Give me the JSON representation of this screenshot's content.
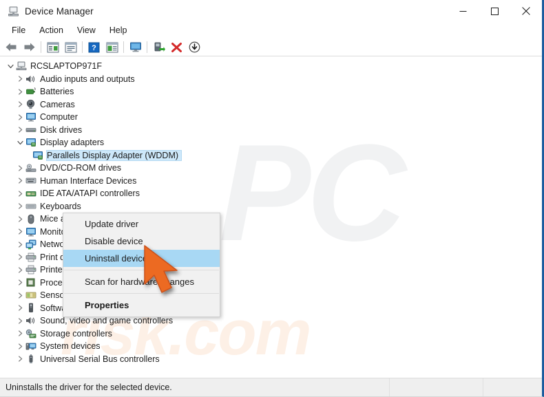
{
  "window": {
    "title": "Device Manager",
    "app_icon": "device-manager-icon",
    "controls": {
      "minimize": "–",
      "maximize": "□",
      "close": "✕"
    }
  },
  "menubar": {
    "items": [
      {
        "label": "File"
      },
      {
        "label": "Action"
      },
      {
        "label": "View"
      },
      {
        "label": "Help"
      }
    ]
  },
  "toolbar": {
    "buttons": [
      {
        "icon": "back-arrow-icon",
        "name": "back-button"
      },
      {
        "icon": "forward-arrow-icon",
        "name": "forward-button"
      },
      {
        "separator": true
      },
      {
        "icon": "show-hide-console-tree-icon",
        "name": "show-console-tree-button"
      },
      {
        "icon": "properties-icon",
        "name": "properties-button"
      },
      {
        "separator": true
      },
      {
        "icon": "help-icon",
        "name": "help-button"
      },
      {
        "icon": "update-driver-icon",
        "name": "update-driver-button"
      },
      {
        "separator": true
      },
      {
        "icon": "scan-hardware-changes-icon",
        "name": "scan-hardware-changes-button"
      },
      {
        "separator": true
      },
      {
        "icon": "enable-device-icon",
        "name": "enable-device-button"
      },
      {
        "icon": "uninstall-device-icon",
        "name": "uninstall-device-button"
      },
      {
        "icon": "disable-device-icon",
        "name": "disable-device-button"
      }
    ]
  },
  "watermark": {
    "logo_text": "PC",
    "site_text": "risk.com"
  },
  "tree": {
    "root": {
      "label": "RCSLAPTOP971F",
      "icon": "computer-root-icon",
      "expanded": true
    },
    "items": [
      {
        "label": "Audio inputs and outputs",
        "icon": "speaker-icon",
        "expanded": false,
        "level": 1
      },
      {
        "label": "Batteries",
        "icon": "battery-icon",
        "expanded": false,
        "level": 1
      },
      {
        "label": "Cameras",
        "icon": "camera-icon",
        "expanded": false,
        "level": 1
      },
      {
        "label": "Computer",
        "icon": "monitor-icon",
        "expanded": false,
        "level": 1
      },
      {
        "label": "Disk drives",
        "icon": "disk-drive-icon",
        "expanded": false,
        "level": 1
      },
      {
        "label": "Display adapters",
        "icon": "display-adapter-icon",
        "expanded": true,
        "level": 1
      },
      {
        "label": "Parallels Display Adapter (WDDM)",
        "icon": "display-adapter-child-icon",
        "selected": true,
        "level": 2
      },
      {
        "label": "DVD/CD-ROM drives",
        "icon": "dvd-drive-icon",
        "expanded": false,
        "level": 1
      },
      {
        "label": "Human Interface Devices",
        "icon": "hid-icon",
        "expanded": false,
        "level": 1
      },
      {
        "label": "IDE ATA/ATAPI controllers",
        "icon": "ide-controller-icon",
        "expanded": false,
        "level": 1
      },
      {
        "label": "Keyboards",
        "icon": "keyboard-icon",
        "expanded": false,
        "level": 1
      },
      {
        "label": "Mice and other pointing devices",
        "icon": "mouse-icon",
        "expanded": false,
        "level": 1
      },
      {
        "label": "Monitors",
        "icon": "monitor-icon",
        "expanded": false,
        "level": 1
      },
      {
        "label": "Network adapters",
        "icon": "network-adapter-icon",
        "expanded": false,
        "level": 1
      },
      {
        "label": "Print queues",
        "icon": "printer-icon",
        "expanded": false,
        "level": 1
      },
      {
        "label": "Printers",
        "icon": "printer-icon",
        "expanded": false,
        "level": 1
      },
      {
        "label": "Processors",
        "icon": "processor-icon",
        "expanded": false,
        "level": 1
      },
      {
        "label": "Sensors",
        "icon": "sensor-icon",
        "expanded": false,
        "level": 1
      },
      {
        "label": "Software devices",
        "icon": "software-device-icon",
        "expanded": false,
        "level": 1
      },
      {
        "label": "Sound, video and game controllers",
        "icon": "speaker-icon",
        "expanded": false,
        "level": 1
      },
      {
        "label": "Storage controllers",
        "icon": "storage-controller-icon",
        "expanded": false,
        "level": 1
      },
      {
        "label": "System devices",
        "icon": "system-device-icon",
        "expanded": false,
        "level": 1
      },
      {
        "label": "Universal Serial Bus controllers",
        "icon": "usb-controller-icon",
        "expanded": false,
        "level": 1
      }
    ]
  },
  "context_menu": {
    "items": [
      {
        "label": "Update driver",
        "type": "item",
        "highlighted": false,
        "bold": false
      },
      {
        "label": "Disable device",
        "type": "item",
        "highlighted": false,
        "bold": false
      },
      {
        "label": "Uninstall device",
        "type": "item",
        "highlighted": true,
        "bold": false
      },
      {
        "type": "separator"
      },
      {
        "label": "Scan for hardware changes",
        "type": "item",
        "highlighted": false,
        "bold": false
      },
      {
        "type": "separator"
      },
      {
        "label": "Properties",
        "type": "item",
        "highlighted": false,
        "bold": true
      }
    ]
  },
  "statusbar": {
    "message": "Uninstalls the driver for the selected device.",
    "pane2": "",
    "pane3": ""
  },
  "colors": {
    "selection_blue": "#cde8fa",
    "menu_highlight_blue": "#a8d8f4",
    "window_border_blue": "#1b5c9e",
    "cursor_orange": "#ec6a23",
    "close_x": "#1b1b1b",
    "toolbar_red_x": "#d42a2a"
  }
}
